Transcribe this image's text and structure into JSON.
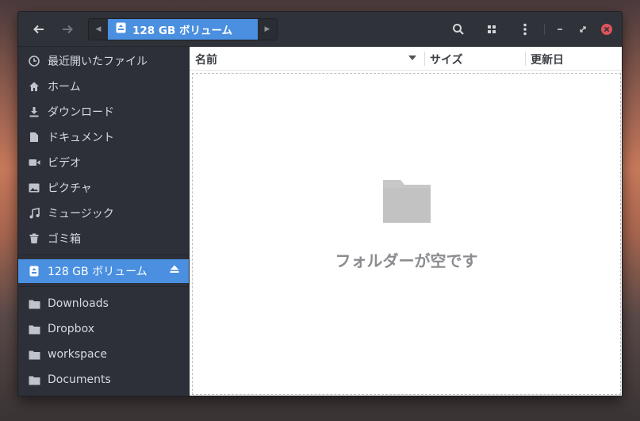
{
  "header": {
    "back_icon": "arrow-left-icon",
    "forward_icon": "arrow-right-icon",
    "path_current": "128 GB ボリューム",
    "search_icon": "search-icon",
    "view_icon": "grid-view-icon",
    "menu_icon": "kebab-menu-icon",
    "minimize_icon": "minimize-icon",
    "maximize_icon": "maximize-icon",
    "close_icon": "close-icon"
  },
  "sidebar": {
    "places": [
      {
        "label": "最近開いたファイル",
        "icon": "clock-icon"
      },
      {
        "label": "ホーム",
        "icon": "home-icon"
      },
      {
        "label": "ダウンロード",
        "icon": "download-icon"
      },
      {
        "label": "ドキュメント",
        "icon": "document-icon"
      },
      {
        "label": "ビデオ",
        "icon": "video-icon"
      },
      {
        "label": "ピクチャ",
        "icon": "picture-icon"
      },
      {
        "label": "ミュージック",
        "icon": "music-icon"
      },
      {
        "label": "ゴミ箱",
        "icon": "trash-icon"
      }
    ],
    "devices": [
      {
        "label": "128 GB ボリューム",
        "icon": "drive-icon",
        "active": true,
        "eject_icon": "eject-icon"
      }
    ],
    "bookmarks": [
      {
        "label": "Downloads",
        "icon": "folder-icon"
      },
      {
        "label": "Dropbox",
        "icon": "folder-icon"
      },
      {
        "label": "workspace",
        "icon": "folder-icon"
      },
      {
        "label": "Documents",
        "icon": "folder-icon"
      }
    ]
  },
  "columns": {
    "name": "名前",
    "size": "サイズ",
    "modified": "更新日"
  },
  "empty_state": {
    "icon": "folder-icon",
    "message": "フォルダーが空です"
  },
  "colors": {
    "accent": "#4a8fe0",
    "sidebar_bg": "#2d3038",
    "close_button": "#e0535b"
  }
}
